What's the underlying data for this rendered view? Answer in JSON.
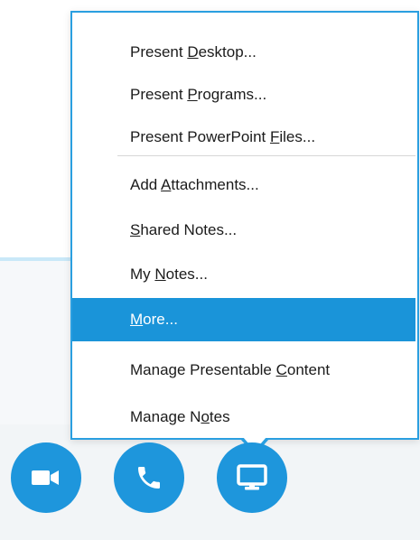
{
  "menu": {
    "items": [
      {
        "pre": "Present ",
        "u": "D",
        "post": "esktop..."
      },
      {
        "pre": "Present ",
        "u": "P",
        "post": "rograms..."
      },
      {
        "pre": "Present PowerPoint ",
        "u": "F",
        "post": "iles..."
      },
      {
        "pre": "Add ",
        "u": "A",
        "post": "ttachments..."
      },
      {
        "pre": "",
        "u": "S",
        "post": "hared Notes..."
      },
      {
        "pre": "My ",
        "u": "N",
        "post": "otes..."
      },
      {
        "pre": "",
        "u": "M",
        "post": "ore..."
      },
      {
        "pre": "Manage Presentable ",
        "u": "C",
        "post": "ontent"
      },
      {
        "pre": "Manage N",
        "u": "o",
        "post": "tes"
      }
    ],
    "selected_index": 6
  },
  "toolbar": {
    "buttons": [
      {
        "name": "video-button",
        "icon": "video-camera-icon"
      },
      {
        "name": "call-button",
        "icon": "phone-icon"
      },
      {
        "name": "present-button",
        "icon": "monitor-icon"
      }
    ]
  },
  "colors": {
    "accent": "#1e96dc",
    "menu_border": "#2a9fe0",
    "selected_bg": "#1a94d9"
  }
}
